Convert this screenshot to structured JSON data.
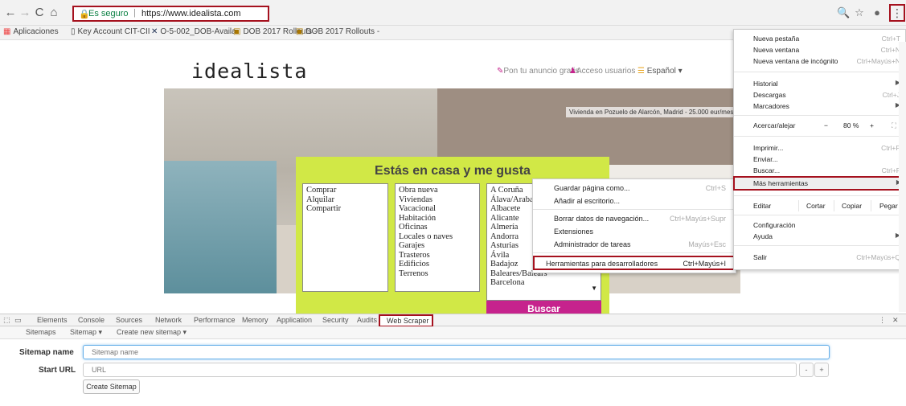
{
  "browser": {
    "nav": {
      "back": "←",
      "forward": "→",
      "reload": "C",
      "home": "⌂"
    },
    "omnibox": {
      "secure_label": "Es seguro",
      "separator": "|",
      "url": "https://www.idealista.com"
    },
    "icons": {
      "zoom": "🔍",
      "star": "☆",
      "extension": "●",
      "menu": "⋮"
    }
  },
  "bookmarks": [
    {
      "label": "Aplicaciones"
    },
    {
      "label": "Key Account CIT-CII"
    },
    {
      "label": "O-5-002_DOB-Availa"
    },
    {
      "label": "DOB 2017 Rollouts -"
    },
    {
      "label": "DOB 2017 Rollouts -"
    }
  ],
  "page": {
    "logo": "idealista",
    "links": {
      "publish": "Pon tu anuncio gratis",
      "login": "Acceso usuarios",
      "language": "Español"
    },
    "hero_caption": "Vivienda en Pozuelo de Alarcón, Madrid - 25.000 eur/mes",
    "search_title": "Estás en casa y me gusta",
    "operation_options": [
      "Comprar",
      "Alquilar",
      "Compartir"
    ],
    "type_options": [
      "Obra nueva",
      "Viviendas",
      "Vacacional",
      "Habitación",
      "Oficinas",
      "Locales o naves",
      "Garajes",
      "Trasteros",
      "Edificios",
      "Terrenos"
    ],
    "location_options": [
      "A Coruña",
      "Álava/Araba",
      "Albacete",
      "Alicante",
      "Almería",
      "Andorra",
      "Asturias",
      "Ávila",
      "Badajoz",
      "Baleares/Balears",
      "Barcelona"
    ],
    "search_button": "Buscar"
  },
  "submenu": {
    "items": [
      {
        "label": "Guardar página como...",
        "shortcut": "Ctrl+S"
      },
      {
        "label": "Añadir al escritorio...",
        "shortcut": ""
      },
      {
        "label": "Borrar datos de navegación...",
        "shortcut": "Ctrl+Mayús+Supr"
      },
      {
        "label": "Extensiones",
        "shortcut": ""
      },
      {
        "label": "Administrador de tareas",
        "shortcut": "Mayús+Esc"
      },
      {
        "label": "Herramientas para desarrolladores",
        "shortcut": "Ctrl+Mayús+I"
      }
    ]
  },
  "mainmenu": {
    "new_tab": {
      "label": "Nueva pestaña",
      "shortcut": "Ctrl+T"
    },
    "new_window": {
      "label": "Nueva ventana",
      "shortcut": "Ctrl+N"
    },
    "incognito": {
      "label": "Nueva ventana de incógnito",
      "shortcut": "Ctrl+Mayús+N"
    },
    "history": {
      "label": "Historial"
    },
    "downloads": {
      "label": "Descargas",
      "shortcut": "Ctrl+J"
    },
    "bookmarks": {
      "label": "Marcadores"
    },
    "zoom": {
      "label": "Acercar/alejar",
      "minus": "−",
      "value": "80 %",
      "plus": "+",
      "fullscreen": "⛶"
    },
    "print": {
      "label": "Imprimir...",
      "shortcut": "Ctrl+P"
    },
    "cast": {
      "label": "Enviar..."
    },
    "find": {
      "label": "Buscar...",
      "shortcut": "Ctrl+F"
    },
    "more_tools": {
      "label": "Más herramientas"
    },
    "edit": {
      "label": "Editar",
      "cut": "Cortar",
      "copy": "Copiar",
      "paste": "Pegar"
    },
    "settings": {
      "label": "Configuración"
    },
    "help": {
      "label": "Ayuda"
    },
    "exit": {
      "label": "Salir",
      "shortcut": "Ctrl+Mayús+Q"
    }
  },
  "devtools": {
    "tabs": [
      "Elements",
      "Console",
      "Sources",
      "Network",
      "Performance",
      "Memory",
      "Application",
      "Security",
      "Audits"
    ],
    "active_tab": "Web Scraper",
    "ws_nav": {
      "sitemaps": "Sitemaps",
      "sitemap": "Sitemap ▾",
      "create": "Create new sitemap ▾"
    },
    "form": {
      "sitemap_name_label": "Sitemap name",
      "sitemap_name_placeholder": "Sitemap name",
      "start_url_label": "Start URL",
      "start_url_placeholder": "URL",
      "minus": "-",
      "plus": "+",
      "create_button": "Create Sitemap"
    }
  }
}
